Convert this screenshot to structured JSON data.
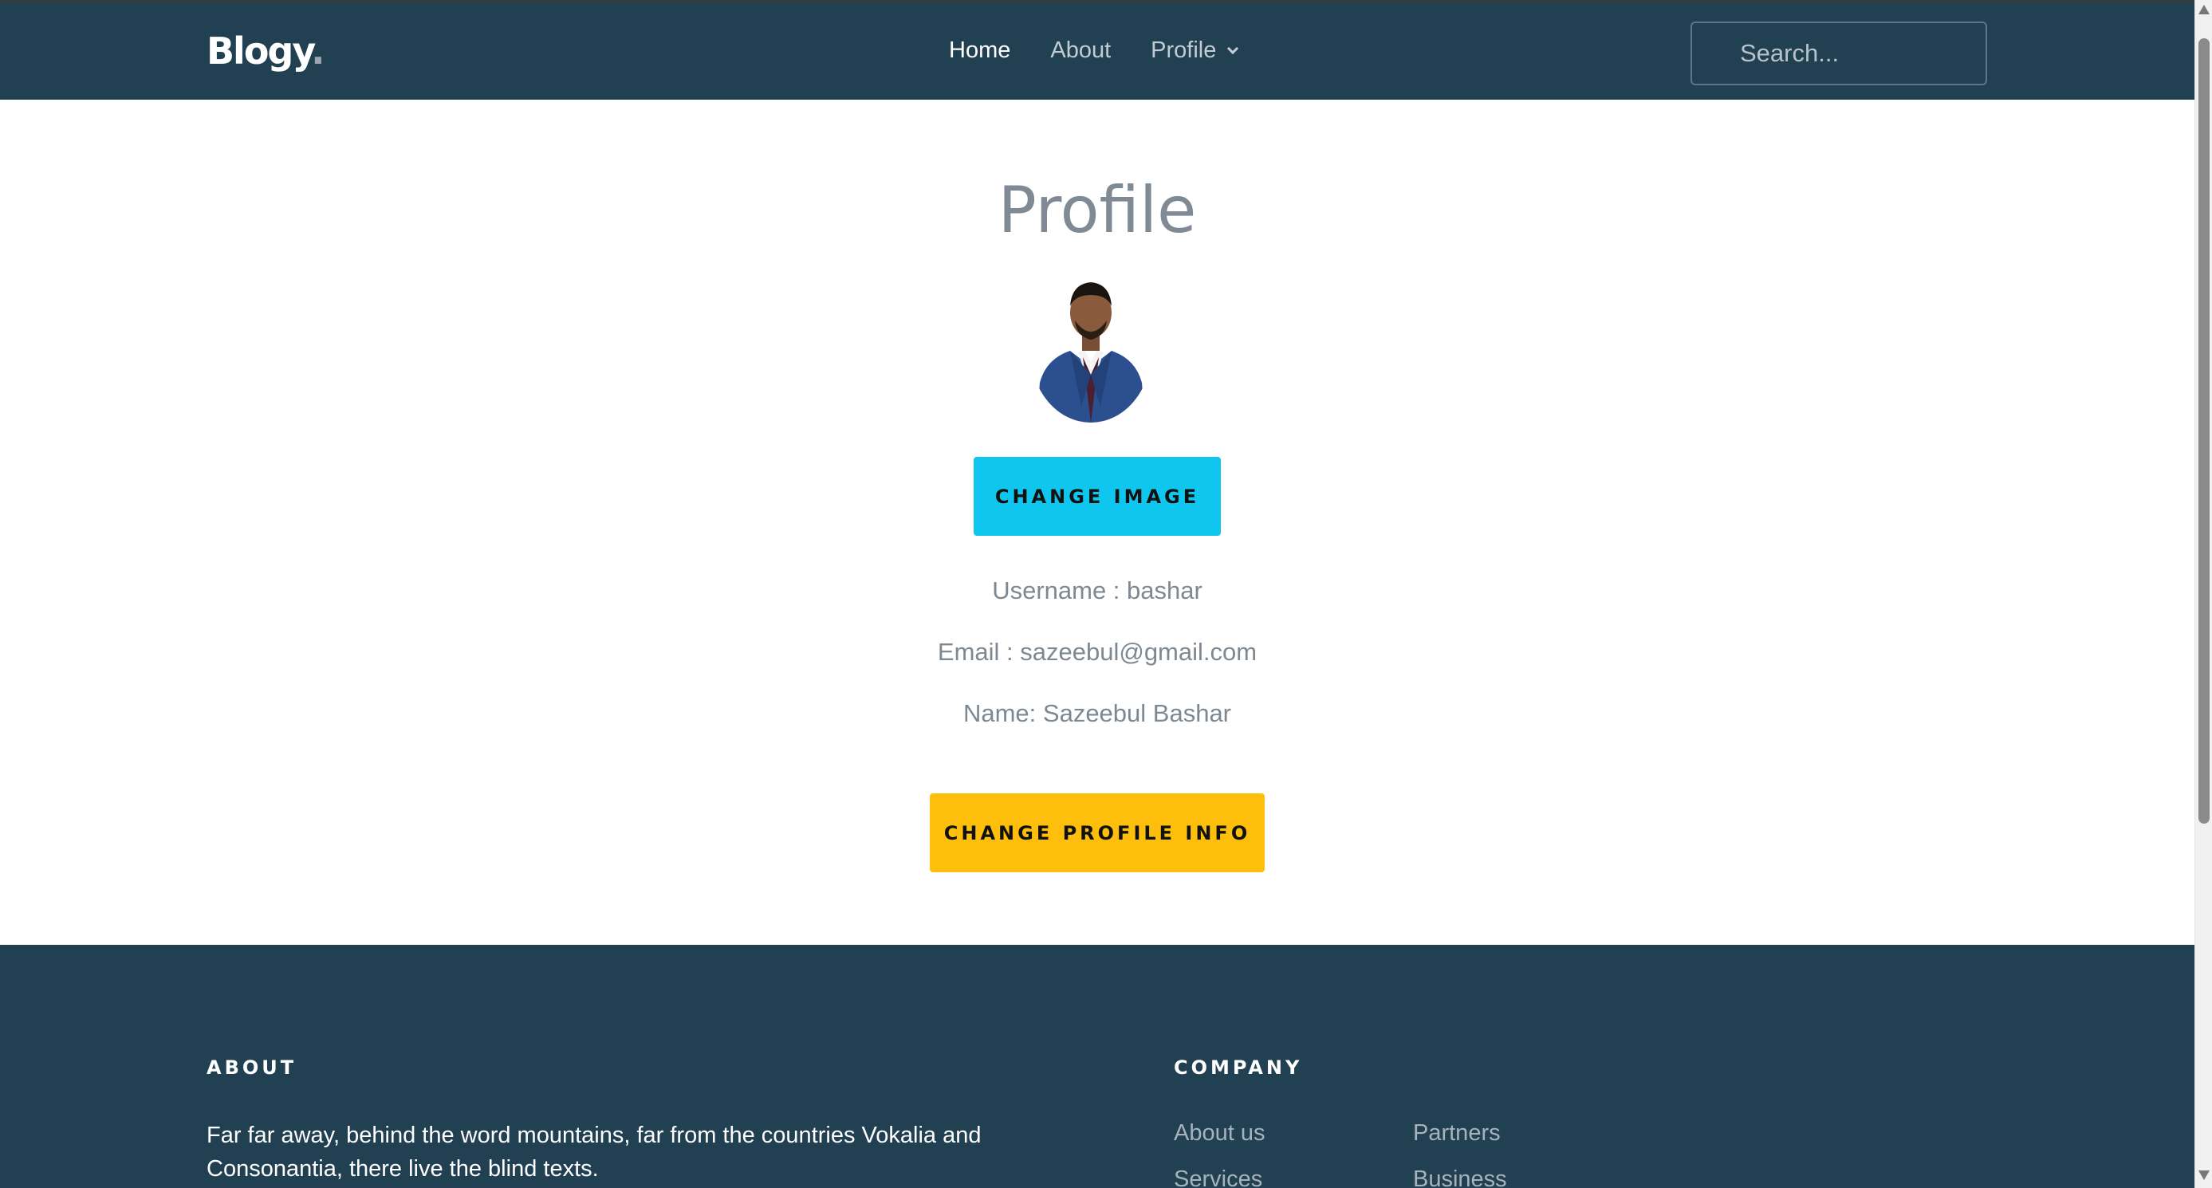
{
  "navbar": {
    "logo": "Blogy",
    "logo_dot": ".",
    "links": {
      "home": "Home",
      "about": "About",
      "profile": "Profile"
    },
    "search_placeholder": "Search..."
  },
  "profile": {
    "title": "Profile",
    "change_image_label": "CHANGE IMAGE",
    "username": "Username : bashar",
    "email": "Email : sazeebul@gmail.com",
    "name": "Name: Sazeebul Bashar",
    "change_info_label": "CHANGE PROFILE INFO"
  },
  "footer": {
    "about_heading": "ABOUT",
    "about_text": "Far far away, behind the word mountains, far from the countries Vokalia and Consonantia, there live the blind texts.",
    "company_heading": "COMPANY",
    "company_links": [
      "About us",
      "Partners",
      "Services",
      "Business"
    ]
  },
  "colors": {
    "navbar_bg": "#214052",
    "accent_cyan": "#0ec6ee",
    "accent_yellow": "#fdbf0c"
  }
}
